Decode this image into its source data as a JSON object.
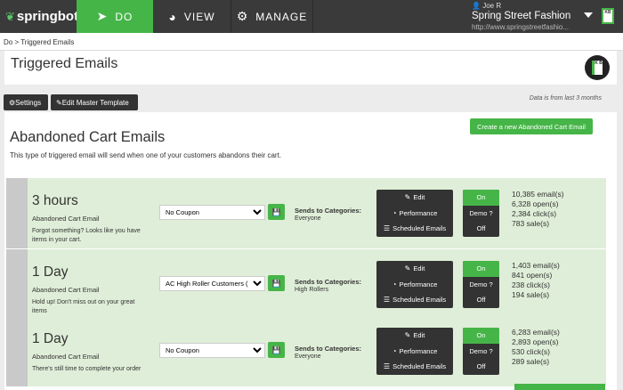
{
  "topbar": {
    "logo_text": "springbot",
    "nav": [
      {
        "label": "DO",
        "icon": "paper-plane-icon"
      },
      {
        "label": "VIEW",
        "icon": "pie-chart-icon"
      },
      {
        "label": "MANAGE",
        "icon": "gears-icon"
      }
    ],
    "account": {
      "user": "Joe R",
      "store": "Spring Street Fashion",
      "url": "http://www.springstreetfashio..."
    },
    "kb_label": "KB"
  },
  "breadcrumb": "Do > Triggered Emails",
  "page_title": "Triggered Emails",
  "toolbar": {
    "settings_label": "Settings",
    "master_label": "Edit Master Template",
    "note": "Data is from last 3 months"
  },
  "section": {
    "title": "Abandoned Cart Emails",
    "description": "This type of triggered email will send when one of your customers abandons their cart.",
    "create_label": "Create a new Abandoned Cart Email"
  },
  "emails": [
    {
      "delay": "3 hours",
      "kind": "Abandoned Cart Email",
      "subject": "Forgot something? Looks like you have items in your cart.",
      "coupon": "No Coupon",
      "sends_label": "Sends to Categories:",
      "sends_to": "Everyone",
      "edit": "Edit",
      "performance": "Performance",
      "scheduled": "Scheduled Emails",
      "on": "On",
      "demo": "Demo",
      "off": "Off",
      "stats": [
        "10,385 email(s)",
        "6,328 open(s)",
        "2,384 click(s)",
        "783 sale(s)"
      ]
    },
    {
      "delay": "1 Day",
      "kind": "Abandoned Cart Email",
      "subject": "Hold up! Don't miss out on your great items",
      "coupon": "AC High Roller Customers (20%)",
      "sends_label": "Sends to Categories:",
      "sends_to": "High Rollers",
      "edit": "Edit",
      "performance": "Performance",
      "scheduled": "Scheduled Emails",
      "on": "On",
      "demo": "Demo",
      "off": "Off",
      "stats": [
        "1,403 email(s)",
        "841 open(s)",
        "238 click(s)",
        "194 sale(s)"
      ]
    },
    {
      "delay": "1 Day",
      "kind": "Abandoned Cart Email",
      "subject": "There's still time to complete your order",
      "coupon": "No Coupon",
      "sends_label": "Sends to Categories:",
      "sends_to": "Everyone",
      "edit": "Edit",
      "performance": "Performance",
      "scheduled": "Scheduled Emails",
      "on": "On",
      "demo": "Demo",
      "off": "Off",
      "stats": [
        "6,283 email(s)",
        "2,893 open(s)",
        "530 click(s)",
        "289 sale(s)"
      ]
    }
  ],
  "colors": {
    "brand_green": "#46b548",
    "dark": "#333333",
    "row_bg": "#dfeed8"
  }
}
